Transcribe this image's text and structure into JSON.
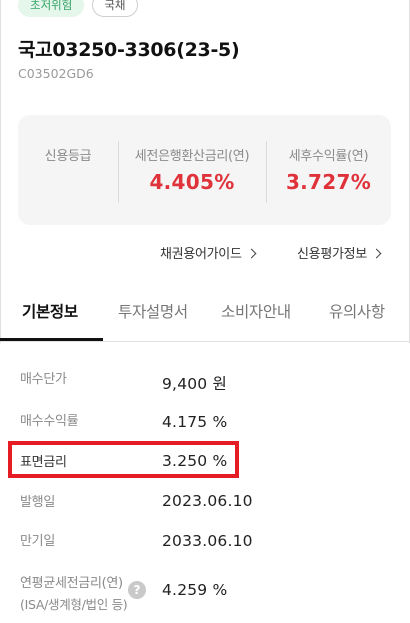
{
  "badges": [
    "초저위험",
    "국채"
  ],
  "bond": {
    "title": "국고03250-3306(23-5)",
    "code": "C03502GD6"
  },
  "rates": {
    "credit_rating_label": "신용등급",
    "credit_rating_value": "",
    "pretax_label": "세전은행환산금리(연)",
    "pretax_value": "4.405%",
    "aftertax_label": "세후수익률(연)",
    "aftertax_value": "3.727%"
  },
  "links": {
    "bond_guide": "채권용어가이드",
    "credit_info": "신용평가정보"
  },
  "tabs": [
    "기본정보",
    "투자설명서",
    "소비자안내",
    "유의사항"
  ],
  "info": {
    "price_label": "매수단가",
    "price_value": "9,400 원",
    "yield_label": "매수수익률",
    "yield_value": "4.175 %",
    "coupon_label": "표면금리",
    "coupon_value": "3.250 %",
    "issue_label": "발행일",
    "issue_value": "2023.06.10",
    "maturity_label": "만기일",
    "maturity_value": "2033.06.10",
    "annual_label": "연평균세전금리(연)",
    "annual_sub": "(ISA/생계형/법인 등)",
    "annual_value": "4.259 %"
  },
  "colors": {
    "accent_red": "#e0323a",
    "highlight_red": "#e51c23",
    "badge_green": "#36a467"
  },
  "icons": [
    "chevron-right-icon",
    "help-icon"
  ]
}
